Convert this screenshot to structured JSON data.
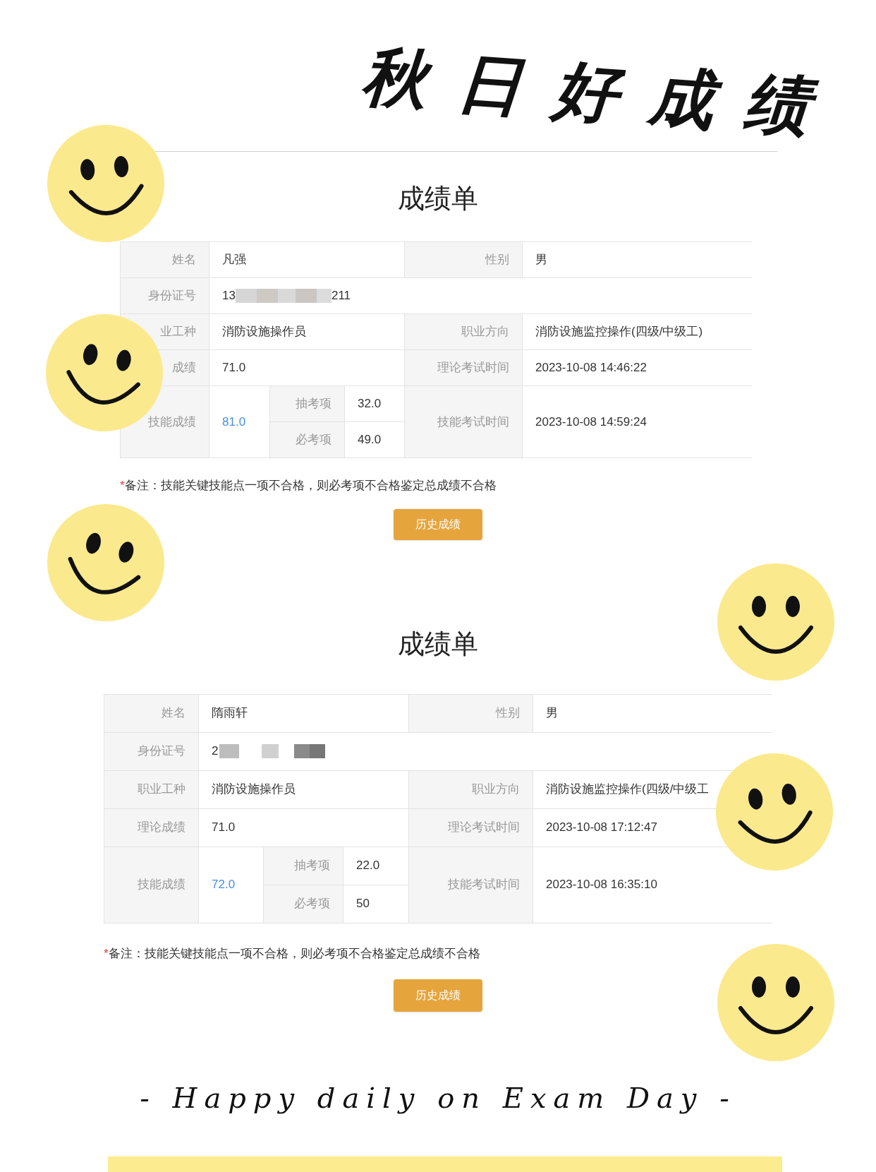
{
  "title": "秋日好成绩",
  "reports": [
    {
      "heading": "成绩单",
      "name_label": "姓名",
      "name": "凡强",
      "gender_label": "性别",
      "gender": "男",
      "id_label": "身份证号",
      "id_start": "13",
      "id_end": "211",
      "occupation_label": "业工种",
      "occupation": "消防设施操作员",
      "direction_label": "职业方向",
      "direction": "消防设施监控操作(四级/中级工)",
      "theory_label": "成绩",
      "theory": "71.0",
      "theory_time_label": "理论考试时间",
      "theory_time": "2023-10-08 14:46:22",
      "skill_label": "技能成绩",
      "skill": "81.0",
      "subs": [
        {
          "label": "抽考项",
          "value": "32.0"
        },
        {
          "label": "必考项",
          "value": "49.0"
        }
      ],
      "skill_time_label": "技能考试时间",
      "skill_time": "2023-10-08 14:59:24",
      "note_mark": "*",
      "note": "备注：技能关键技能点一项不合格，则必考项不合格鉴定总成绩不合格",
      "button": "历史成绩"
    },
    {
      "heading": "成绩单",
      "name_label": "姓名",
      "name": "隋雨轩",
      "gender_label": "性别",
      "gender": "男",
      "id_label": "身份证号",
      "id_start": "2",
      "occupation_label": "职业工种",
      "occupation": "消防设施操作员",
      "direction_label": "职业方向",
      "direction": "消防设施监控操作(四级/中级工",
      "theory_label": "理论成绩",
      "theory": "71.0",
      "theory_time_label": "理论考试时间",
      "theory_time": "2023-10-08 17:12:47",
      "skill_label": "技能成绩",
      "skill": "72.0",
      "subs": [
        {
          "label": "抽考项",
          "value": "22.0"
        },
        {
          "label": "必考项",
          "value": "50"
        }
      ],
      "skill_time_label": "技能考试时间",
      "skill_time": "2023-10-08 16:35:10",
      "note_mark": "*",
      "note": "备注：技能关键技能点一项不合格，则必考项不合格鉴定总成绩不合格",
      "button": "历史成绩"
    }
  ],
  "footer": "- Happy daily on Exam Day -"
}
